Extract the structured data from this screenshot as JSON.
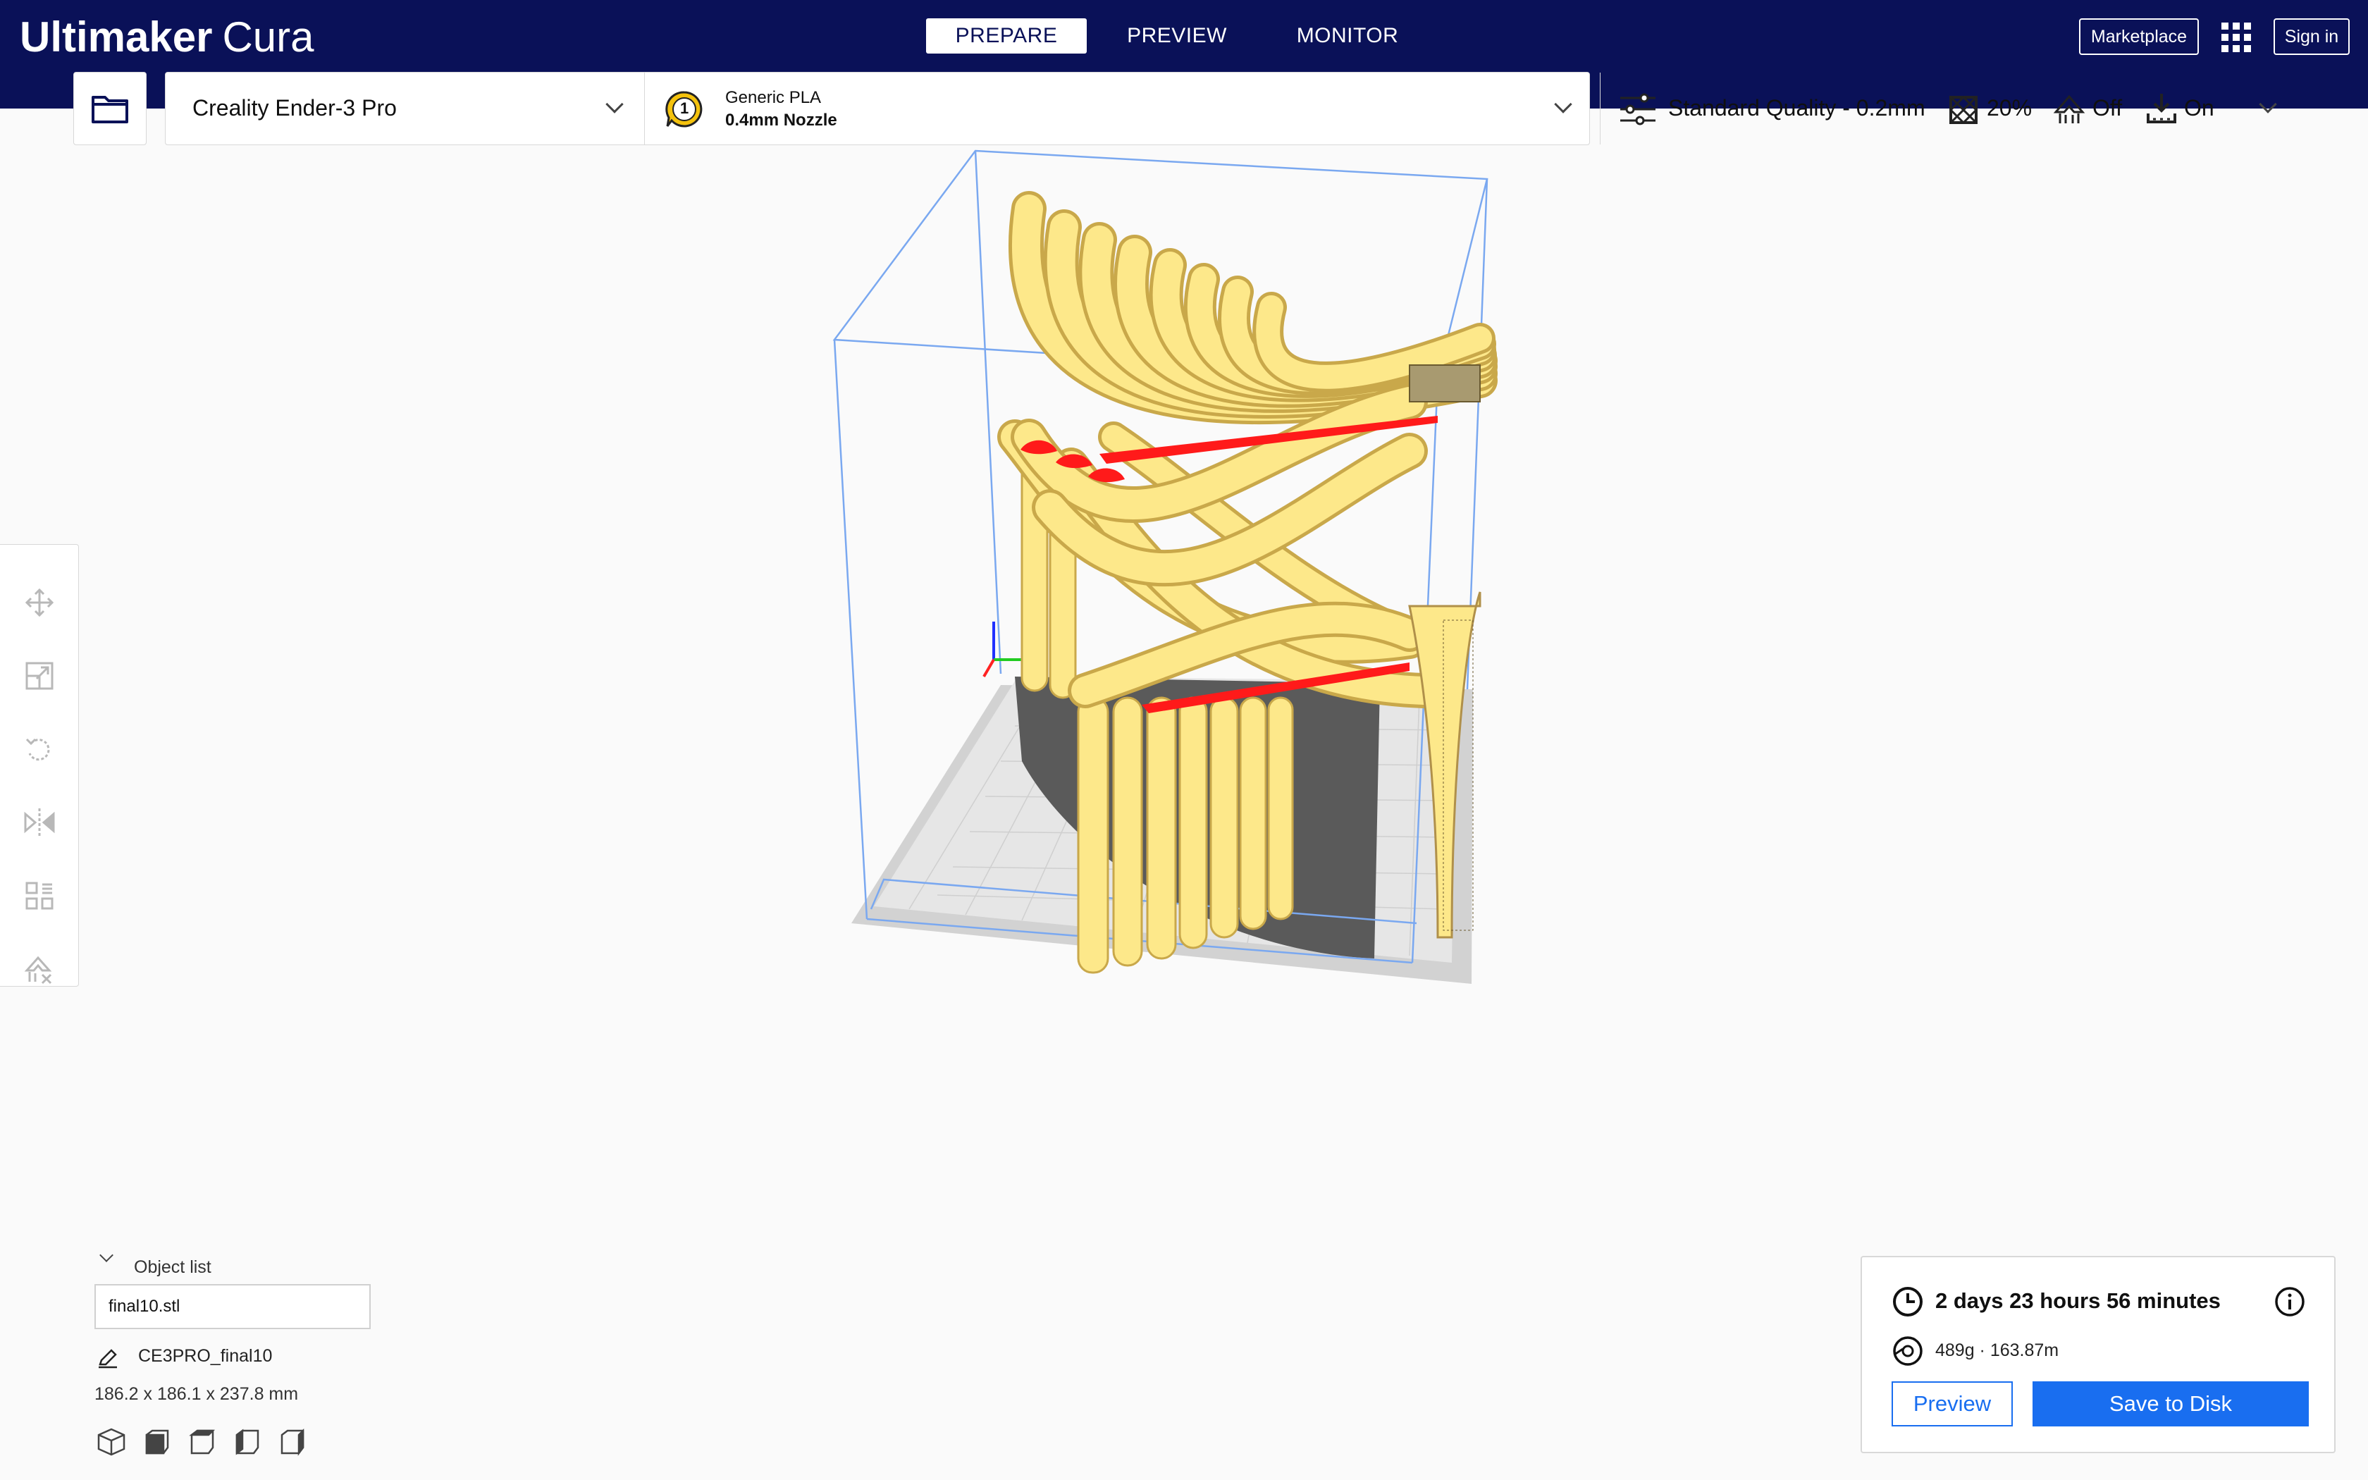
{
  "app": {
    "logo_bold": "Ultimaker",
    "logo_light": "Cura"
  },
  "header": {
    "stages": [
      {
        "label": "PREPARE",
        "active": true
      },
      {
        "label": "PREVIEW",
        "active": false
      },
      {
        "label": "MONITOR",
        "active": false
      }
    ],
    "marketplace_label": "Marketplace",
    "signin_label": "Sign in",
    "apps_icon": "grid-9-dots-icon"
  },
  "toolbar": {
    "open_icon": "folder-open-icon",
    "printer": "Creality Ender-3 Pro",
    "extruder_number": "1",
    "material": "Generic PLA",
    "nozzle": "0.4mm Nozzle",
    "profile": "Standard Quality - 0.2mm",
    "infill": "20%",
    "support": "Off",
    "adhesion": "On"
  },
  "tools": [
    {
      "name": "move-tool-icon"
    },
    {
      "name": "scale-tool-icon"
    },
    {
      "name": "rotate-tool-icon"
    },
    {
      "name": "mirror-tool-icon"
    },
    {
      "name": "per-model-settings-icon"
    },
    {
      "name": "support-blocker-icon"
    }
  ],
  "object_list": {
    "header": "Object list",
    "object_name": "final10.stl",
    "job_name": "CE3PRO_final10",
    "dimensions": "186.2 x 186.1 x 237.8 mm",
    "view_icons": [
      "3d-view-icon",
      "front-view-icon",
      "top-view-icon",
      "left-view-icon",
      "right-view-icon"
    ]
  },
  "print": {
    "time": "2 days 23 hours 56 minutes",
    "material_usage": "489g · 163.87m",
    "preview_label": "Preview",
    "save_label": "Save to Disk"
  },
  "colors": {
    "header_bg": "#0a1158",
    "accent_blue": "#196ef0",
    "model_yellow": "#fde88a",
    "overhang_red": "#ff1a1a",
    "build_volume_line": "#7aa8f0"
  }
}
